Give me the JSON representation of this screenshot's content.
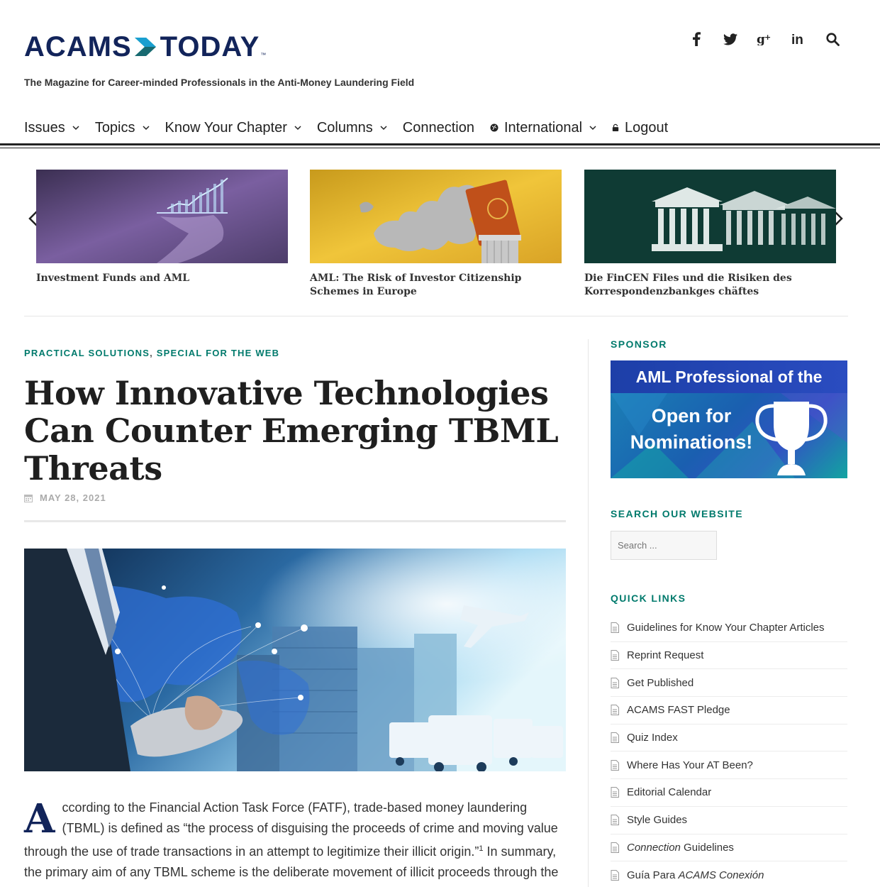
{
  "header": {
    "logo_left": "ACAMS",
    "logo_right": "TODAY",
    "logo_tm": "™",
    "tagline": "The Magazine for Career-minded Professionals in the Anti-Money Laundering Field",
    "social": [
      {
        "icon": "facebook-icon",
        "glyph": "f"
      },
      {
        "icon": "twitter-icon",
        "glyph": "t"
      },
      {
        "icon": "google-plus-icon",
        "glyph": "g+"
      },
      {
        "icon": "linkedin-icon",
        "glyph": "in"
      },
      {
        "icon": "search-icon",
        "glyph": "search"
      }
    ]
  },
  "nav": {
    "items": [
      {
        "label": "Issues",
        "dropdown": true
      },
      {
        "label": "Topics",
        "dropdown": true
      },
      {
        "label": "Know Your Chapter",
        "dropdown": true
      },
      {
        "label": "Columns",
        "dropdown": true
      },
      {
        "label": "Connection",
        "dropdown": false
      },
      {
        "label": "International",
        "dropdown": true,
        "icon": "globe-icon"
      },
      {
        "label": "Logout",
        "dropdown": false,
        "icon": "lock-icon"
      }
    ]
  },
  "carousel": {
    "slides": [
      {
        "title": "Investment Funds and AML",
        "image": "purple-chart-hand-image"
      },
      {
        "title": "AML: The Risk of Investor Citizenship Schemes in Europe",
        "image": "europe-passport-image"
      },
      {
        "title": "Die FinCEN Files und die Risiken des Korrespondenzbankges chäftes",
        "image": "bank-columns-image"
      }
    ]
  },
  "article": {
    "category_1": "PRACTICAL SOLUTIONS",
    "category_sep": ",",
    "category_2": "SPECIAL FOR THE WEB",
    "title": "How Innovative Technologies Can Counter Emerging TBML Threats",
    "date": "MAY 28, 2021",
    "drop_cap": "A",
    "body_part1": "ccording to the Financial Action Task Force (FATF), trade-based money laundering (TBML) is defined as “the process of disguising the proceeds of crime and moving value through the use of trade transactions in an attempt to legitimize their illicit origin.”",
    "footnote": "1",
    "body_part2": " In summary, the primary aim of any TBML scheme is the deliberate movement of illicit proceeds through the"
  },
  "sidebar": {
    "sponsor_heading": "SPONSOR",
    "sponsor_banner_title": "AML Professional of the Month",
    "sponsor_banner_line1": "Open for",
    "sponsor_banner_line2": "Nominations!",
    "search_heading": "SEARCH OUR WEBSITE",
    "search_placeholder": "Search ...",
    "quicklinks_heading": "QUICK LINKS",
    "quicklinks": [
      "Guidelines for Know Your Chapter Articles",
      "Reprint Request",
      "Get Published",
      "ACAMS FAST Pledge",
      "Quiz Index",
      "Where Has Your AT Been?",
      "Editorial Calendar",
      "Style Guides"
    ],
    "ql_connection_em": "Connection",
    "ql_connection_rest": " Guidelines",
    "ql_guia_prefix": "Guía Para ",
    "ql_guia_em": "ACAMS Conexión"
  },
  "colors": {
    "brand_navy": "#12245a",
    "brand_teal": "#007a6c",
    "accent_green": "#1fbf8f"
  }
}
